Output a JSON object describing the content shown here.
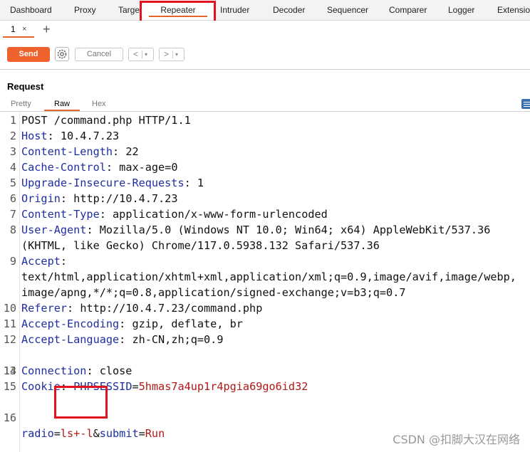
{
  "top_tabs": [
    {
      "label": "Dashboard"
    },
    {
      "label": "Proxy"
    },
    {
      "label": "Target"
    },
    {
      "label": "Repeater"
    },
    {
      "label": "Intruder"
    },
    {
      "label": "Decoder"
    },
    {
      "label": "Sequencer"
    },
    {
      "label": "Comparer"
    },
    {
      "label": "Logger"
    },
    {
      "label": "Extensions"
    }
  ],
  "active_tab": "Repeater",
  "sub_tab": {
    "label": "1",
    "close": "×",
    "add": "+"
  },
  "toolbar": {
    "send_label": "Send",
    "cancel_label": "Cancel",
    "back": "<",
    "forward": ">",
    "dropdown": "▾"
  },
  "request": {
    "title": "Request",
    "view_tabs": [
      "Pretty",
      "Raw",
      "Hex"
    ],
    "active_view": "Raw",
    "lines": [
      {
        "num": "1",
        "key": "",
        "sep": "",
        "value": "POST /command.php HTTP/1.1"
      },
      {
        "num": "2",
        "key": "Host",
        "sep": ": ",
        "value": "10.4.7.23"
      },
      {
        "num": "3",
        "key": "Content-Length",
        "sep": ": ",
        "value": "22"
      },
      {
        "num": "4",
        "key": "Cache-Control",
        "sep": ": ",
        "value": "max-age=0"
      },
      {
        "num": "5",
        "key": "Upgrade-Insecure-Requests",
        "sep": ": ",
        "value": "1"
      },
      {
        "num": "6",
        "key": "Origin",
        "sep": ": ",
        "value": "http://10.4.7.23"
      },
      {
        "num": "7",
        "key": "Content-Type",
        "sep": ": ",
        "value": "application/x-www-form-urlencoded"
      },
      {
        "num": "8",
        "key": "User-Agent",
        "sep": ": ",
        "value": "Mozilla/5.0 (Windows NT 10.0; Win64; x64) AppleWebKit/537.36"
      },
      {
        "num": "",
        "key": "",
        "sep": "",
        "value": "(KHTML, like Gecko) Chrome/117.0.5938.132 Safari/537.36"
      },
      {
        "num": "9",
        "key": "Accept",
        "sep": ":",
        "value": ""
      },
      {
        "num": "",
        "key": "",
        "sep": "",
        "value": "text/html,application/xhtml+xml,application/xml;q=0.9,image/avif,image/webp,"
      },
      {
        "num": "",
        "key": "",
        "sep": "",
        "value": "image/apng,*/*;q=0.8,application/signed-exchange;v=b3;q=0.7"
      },
      {
        "num": "10",
        "key": "Referer",
        "sep": ": ",
        "value": "http://10.4.7.23/command.php"
      },
      {
        "num": "11",
        "key": "Accept-Encoding",
        "sep": ": ",
        "value": "gzip, deflate, br"
      },
      {
        "num": "12",
        "key": "Accept-Language",
        "sep": ": ",
        "value": "zh-CN,zh;q=0.9"
      },
      {
        "num": "14",
        "key": "Connection",
        "sep": ": ",
        "value": "close"
      },
      {
        "num": "15",
        "key": "",
        "sep": "",
        "value": ""
      }
    ],
    "cookie_line": {
      "num": "13",
      "key": "Cookie",
      "sep": ": ",
      "name": "PHPSESSID",
      "eq": "=",
      "value": "5hmas7a4up1r4pgia69go6id32"
    },
    "body_line": {
      "num": "16",
      "p1": "radio",
      "eq1": "=",
      "v1": "ls+-l",
      "amp": "&",
      "p2": "submit",
      "eq2": "=",
      "v2": "Run"
    }
  },
  "watermark": "CSDN @扣脚大汉在网络"
}
